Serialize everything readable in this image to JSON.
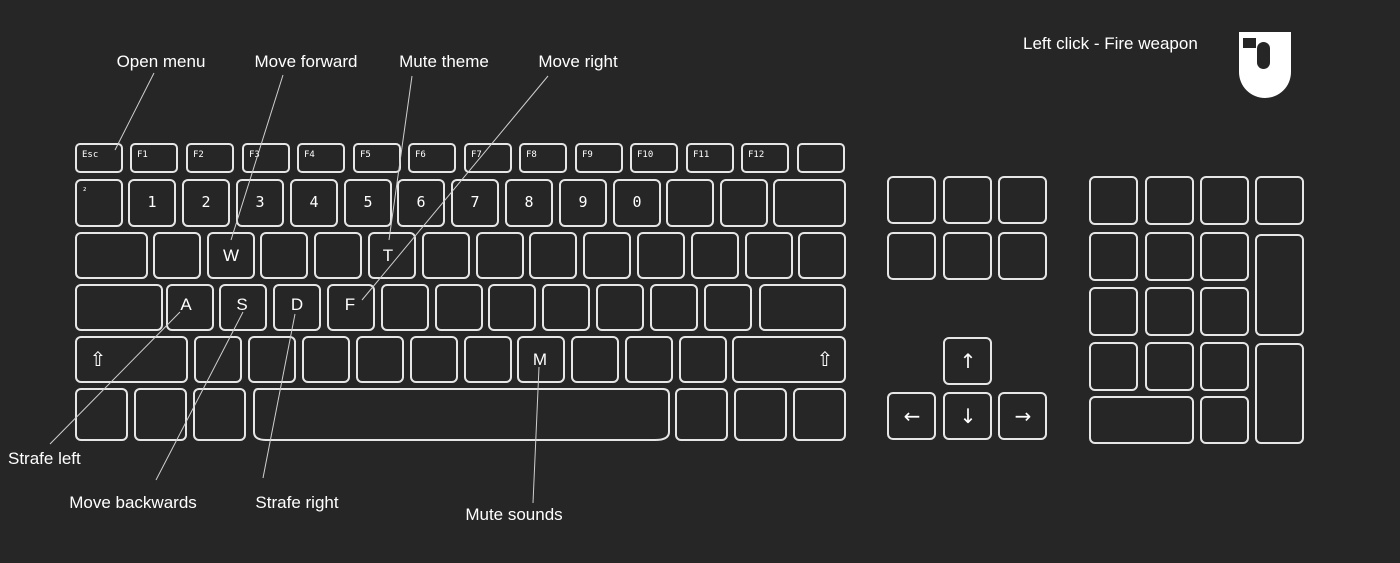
{
  "annotations": {
    "open_menu": "Open menu",
    "move_forward": "Move forward",
    "mute_theme": "Mute theme",
    "move_right": "Move right",
    "strafe_left": "Strafe left",
    "move_backwards": "Move backwards",
    "strafe_right": "Strafe right",
    "mute_sounds": "Mute sounds",
    "fire_weapon": "Left click - Fire weapon"
  },
  "keys": {
    "esc": "Esc",
    "function_row": [
      "F1",
      "F2",
      "F3",
      "F4",
      "F5",
      "F6",
      "F7",
      "F8",
      "F9",
      "F10",
      "F11",
      "F12"
    ],
    "number_row_first": "²",
    "number_row": [
      "1",
      "2",
      "3",
      "4",
      "5",
      "6",
      "7",
      "8",
      "9",
      "0"
    ],
    "w": "W",
    "t": "T",
    "a": "A",
    "s": "S",
    "d": "D",
    "f": "F",
    "m": "M",
    "shift_glyph": "⇧",
    "arrow_up": "↑",
    "arrow_left": "←",
    "arrow_down": "↓",
    "arrow_right": "→"
  },
  "colors": {
    "background": "#262626",
    "key_outline": "#e6e6e6",
    "text": "#ffffff"
  },
  "icons": {
    "mouse": "mouse-icon"
  }
}
